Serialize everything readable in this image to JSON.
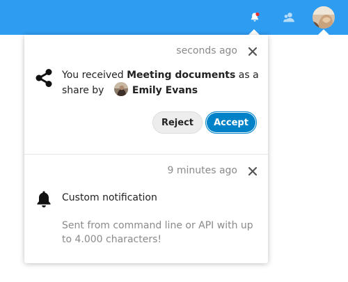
{
  "header": {
    "icons": [
      "bell-icon",
      "contacts-icon",
      "avatar"
    ],
    "notification_dot_color": "#e9322d",
    "background": "#2e9cf0"
  },
  "notifications": [
    {
      "timestamp": "seconds ago",
      "icon": "share-icon",
      "message_prefix": "You received ",
      "file_name": "Meeting documents",
      "message_middle": " as a share by ",
      "user_name": "Emily Evans",
      "reject_label": "Reject",
      "accept_label": "Accept"
    },
    {
      "timestamp": "9 minutes ago",
      "icon": "bell-icon",
      "subject": "Custom notification",
      "body": "Sent from command line or API with up to 4.000 characters!"
    }
  ],
  "colors": {
    "accent": "#0082c9",
    "muted_text": "#8a8a8a"
  }
}
